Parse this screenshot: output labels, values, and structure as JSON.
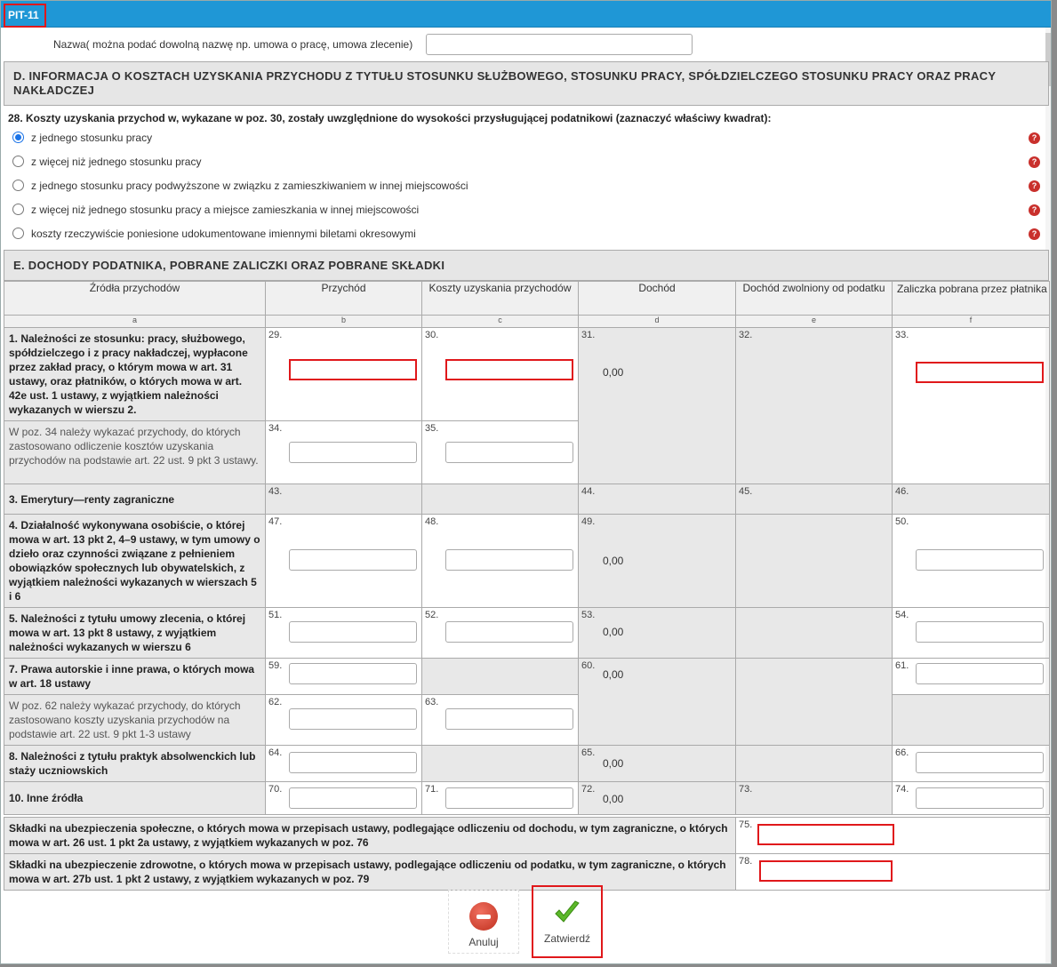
{
  "dialog": {
    "title": "PIT-11"
  },
  "name_field": {
    "label": "Nazwa( można podać dowolną nazwę np. umowa o pracę, umowa zlecenie)",
    "value": ""
  },
  "section_d": {
    "title": "D. INFORMACJA O KOSZTACH UZYSKANIA PRZYCHODU Z TYTUŁU STOSUNKU SŁUŻBOWEGO, STOSUNKU PRACY, SPÓŁDZIELCZEGO STOSUNKU PRACY ORAZ PRACY NAKŁADCZEJ",
    "question": "28. Koszty uzyskania przychod  w, wykazane w poz. 30, zostały uwzględnione do wysokości przysługującej podatnikowi (zaznaczyć właściwy kwadrat):",
    "options": [
      {
        "label": "z jednego stosunku pracy",
        "selected": true
      },
      {
        "label": "z więcej niż jednego stosunku pracy",
        "selected": false
      },
      {
        "label": "z jednego stosunku pracy podwyższone w związku z zamieszkiwaniem w innej miejscowości",
        "selected": false
      },
      {
        "label": "z więcej niż jednego stosunku pracy a miejsce zamieszkania w innej miejscowości",
        "selected": false
      },
      {
        "label": "koszty rzeczywiście poniesione udokumentowane imiennymi biletami okresowymi",
        "selected": false
      }
    ],
    "help_glyph": "?"
  },
  "section_e": {
    "title": "E. DOCHODY PODATNIKA, POBRANE ZALICZKI ORAZ POBRANE SKŁADKI",
    "columns": [
      "Źródła przychodów",
      "Przychód",
      "Koszty uzyskania przychodów",
      "Dochód",
      "Dochód zwolniony od podatku",
      "Zaliczka pobrana przez płatnika"
    ],
    "col_letters": [
      "a",
      "b",
      "c",
      "d",
      "e",
      "f"
    ],
    "rows": {
      "r1_label": "1. Należności ze stosunku: pracy, służbowego, spółdzielczego i z pracy nakładczej, wypłacone przez zakład pracy, o którym mowa w art. 31 ustawy, oraz płatników, o których mowa w art. 42e ust. 1 ustawy, z wyjątkiem należności wykazanych w wierszu 2.",
      "r1_sub_label": "W poz. 34 należy wykazać przychody, do których zastosowano odliczenie kosztów uzyskania przychodów na podstawie art. 22 ust. 9 pkt 3 ustawy.",
      "r3_label": "3. Emerytury—renty zagraniczne",
      "r4_label": "4. Działalność wykonywana osobiście, o której mowa w art. 13 pkt 2, 4–9 ustawy, w tym umowy o dzieło oraz czynności związane z pełnieniem obowiązków społecznych lub obywatelskich, z wyjątkiem należności wykazanych w wierszach 5 i 6",
      "r5_label": "5. Należności z tytułu umowy zlecenia, o której mowa w art. 13 pkt 8 ustawy, z wyjątkiem należności wykazanych w wierszu 6",
      "r7_label": "7. Prawa autorskie i inne prawa, o których mowa w art. 18 ustawy",
      "r7_sub_label": "W poz. 62 należy wykazać przychody, do których zastosowano koszty uzyskania przychodów na podstawie art. 22 ust. 9 pkt 1-3 ustawy",
      "r8_label": "8. Należności z tytułu praktyk absolwenckich lub staży uczniowskich",
      "r10_label": "10. Inne źródła"
    },
    "nums": {
      "p29": "29.",
      "p30": "30.",
      "p31": "31.",
      "p32": "32.",
      "p33": "33.",
      "p34": "34.",
      "p35": "35.",
      "p43": "43.",
      "p44": "44.",
      "p45": "45.",
      "p46": "46.",
      "p47": "47.",
      "p48": "48.",
      "p49": "49.",
      "p50": "50.",
      "p51": "51.",
      "p52": "52.",
      "p53": "53.",
      "p54": "54.",
      "p59": "59.",
      "p60": "60.",
      "p61": "61.",
      "p62": "62.",
      "p63": "63.",
      "p64": "64.",
      "p65": "65.",
      "p66": "66.",
      "p70": "70.",
      "p71": "71.",
      "p72": "72.",
      "p73": "73.",
      "p74": "74.",
      "p75": "75.",
      "p78": "78."
    },
    "values": {
      "v31": "0,00",
      "v49": "0,00",
      "v53": "0,00",
      "v60": "0,00",
      "v65": "0,00",
      "v72": "0,00"
    },
    "contrib_social_label": "Składki na ubezpieczenia społeczne, o których mowa w przepisach ustawy, podlegające odliczeniu od dochodu, w tym zagraniczne, o których mowa w art. 26 ust. 1 pkt 2a ustawy, z wyjątkiem wykazanych w poz. 76",
    "contrib_health_label": "Składki na ubezpieczenie zdrowotne, o których mowa w przepisach ustawy, podlegające odliczeniu od podatku, w tym zagraniczne, o których mowa w art. 27b ust. 1 pkt 2 ustawy, z wyjątkiem wykazanych w poz. 79"
  },
  "footer": {
    "cancel_label": "Anuluj",
    "confirm_label": "Zatwierdź"
  },
  "colors": {
    "titlebar": "#1f97d6",
    "highlight": "#e0181b",
    "radio": "#1a73e8",
    "help": "#c9302c"
  }
}
